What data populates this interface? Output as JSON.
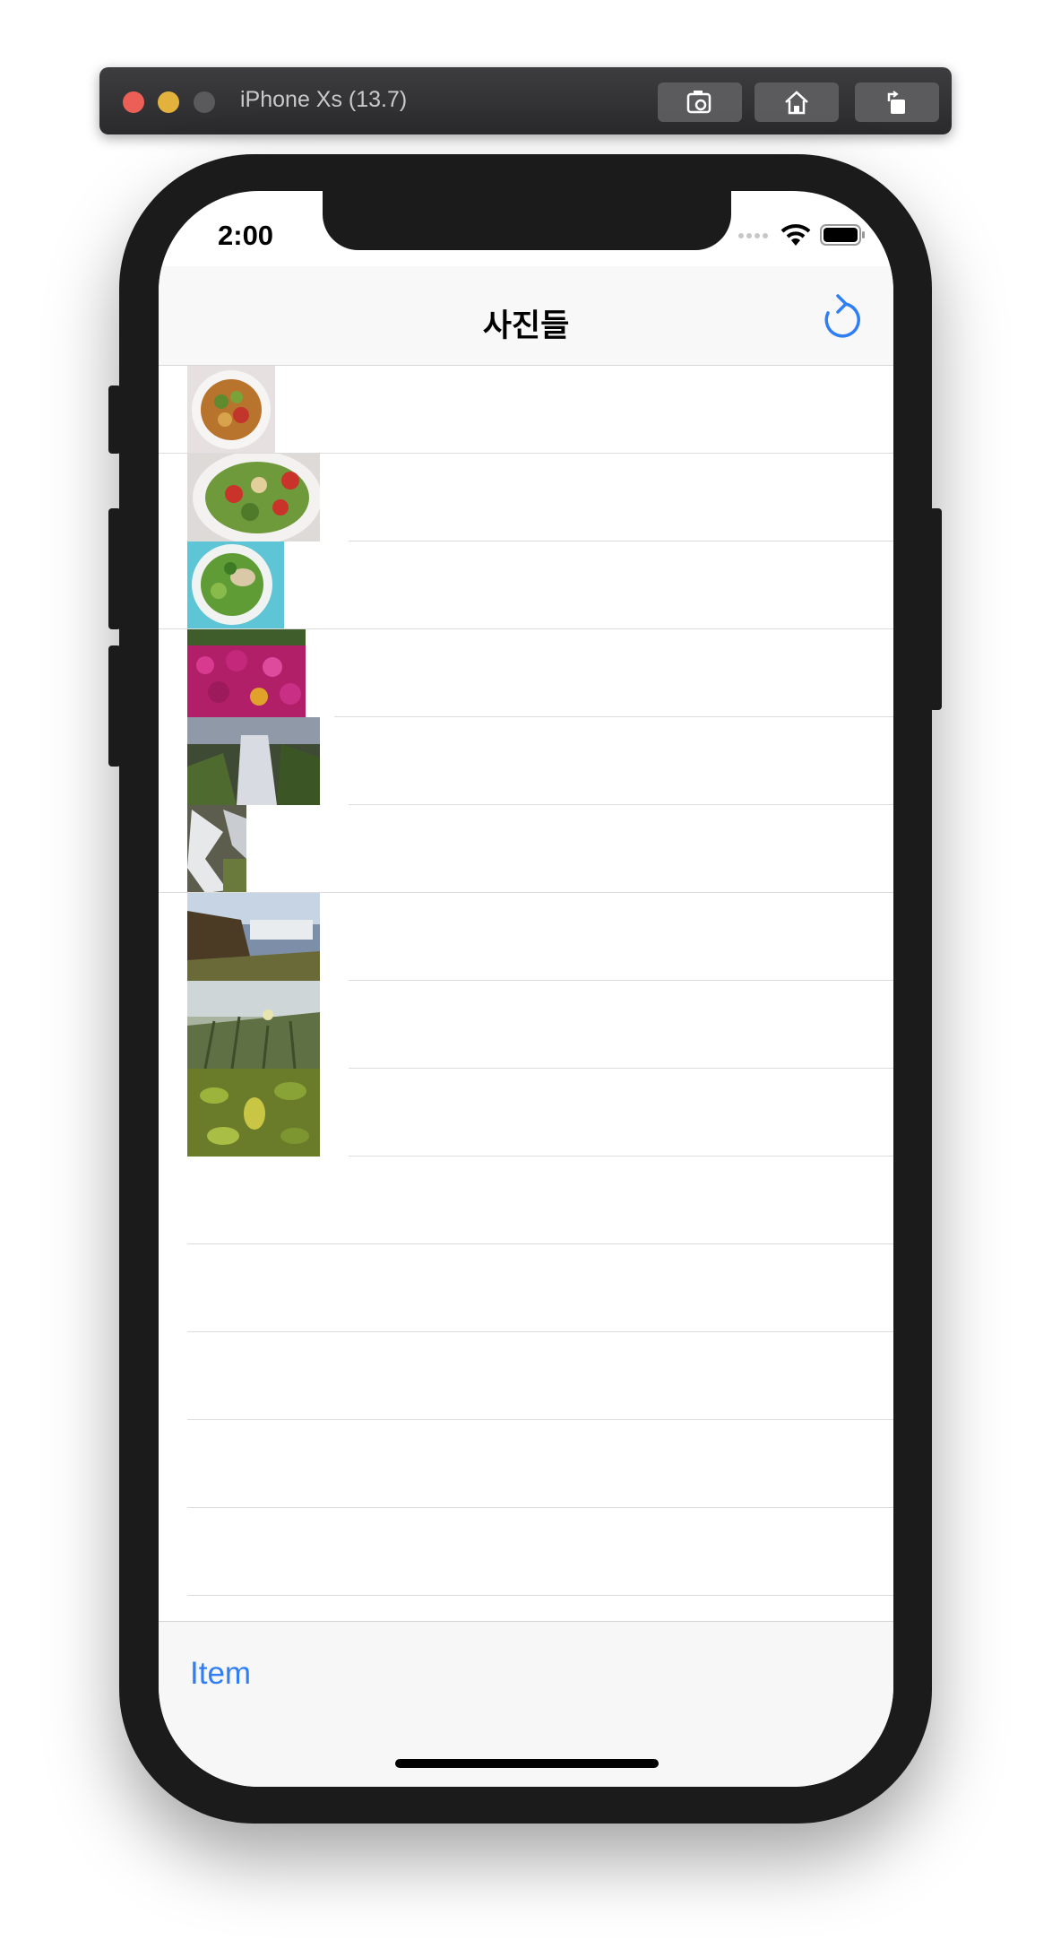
{
  "simulator": {
    "title": "iPhone Xs (13.7)",
    "buttons": [
      "screenshot-icon",
      "home-icon",
      "rotate-icon"
    ]
  },
  "status_bar": {
    "time": "2:00"
  },
  "nav": {
    "title": "사진들",
    "right_icon": "refresh-icon"
  },
  "rows": [
    {
      "image": "pasta salad plate"
    },
    {
      "image": "green salad with tomatoes"
    },
    {
      "image": "salad bowl with chicken"
    },
    {
      "image": "magenta flower field"
    },
    {
      "image": "waterfall in valley"
    },
    {
      "image": "stream over rocks"
    },
    {
      "image": "waterfall cliff coast"
    },
    {
      "image": "grassy hillside"
    },
    {
      "image": "green leaves"
    },
    {
      "image": ""
    },
    {
      "image": ""
    },
    {
      "image": ""
    },
    {
      "image": ""
    },
    {
      "image": ""
    }
  ],
  "toolbar": {
    "item_label": "Item"
  },
  "colors": {
    "accent": "#2f7ef6",
    "nav_bg": "#f8f8f8",
    "device": "#1b1b1c"
  }
}
